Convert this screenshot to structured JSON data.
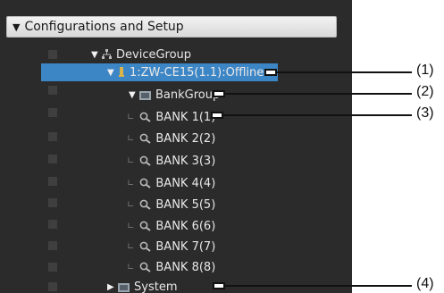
{
  "panel": {
    "title": "Configurations and Setup",
    "tree": {
      "root_label": "DeviceGroup",
      "device_label": "1:ZW-CE15(1.1):Offline",
      "bankgroup_label": "BankGroup",
      "banks": [
        "BANK 1(1)",
        "BANK 2(2)",
        "BANK 3(3)",
        "BANK 4(4)",
        "BANK 5(5)",
        "BANK 6(6)",
        "BANK 7(7)",
        "BANK 8(8)"
      ],
      "system_label": "System"
    }
  },
  "callouts": [
    "(1)",
    "(2)",
    "(3)",
    "(4)"
  ],
  "colors": {
    "panel_bg": "#2b2b2b",
    "selection": "#3d86c6",
    "text": "#e8e8e8"
  },
  "icons": {
    "device_group": "network-tree-icon",
    "device": "device-icon",
    "bank_group": "folder-icon",
    "bank": "magnifier-bank-icon",
    "system": "folder-icon"
  }
}
